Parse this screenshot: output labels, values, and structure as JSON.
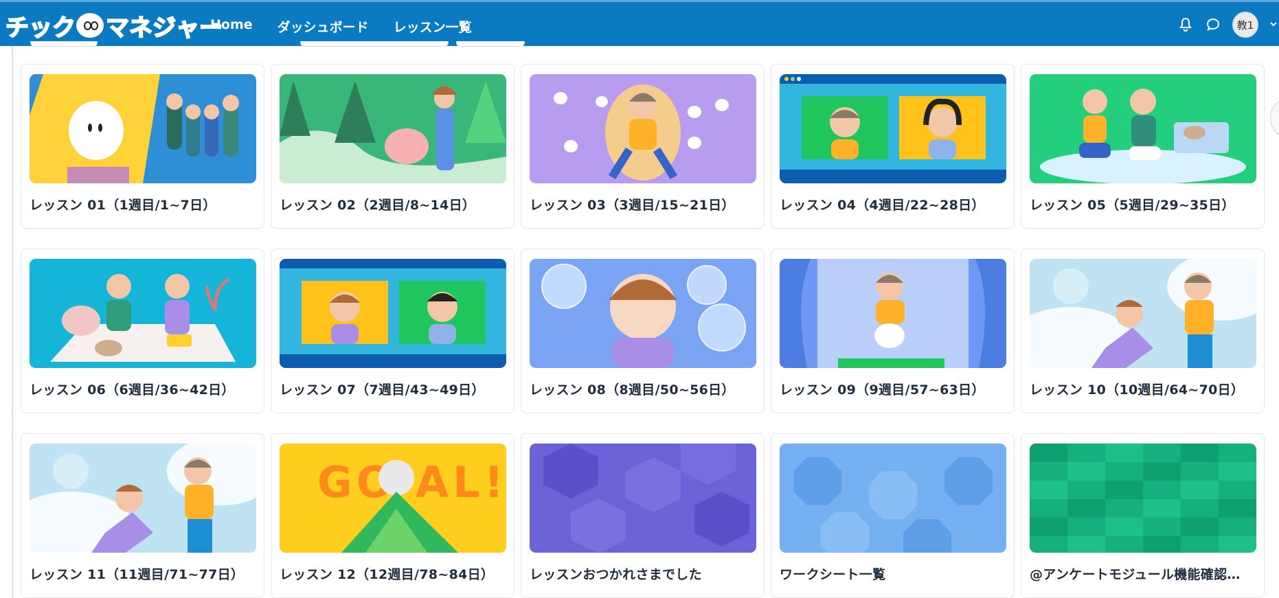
{
  "header": {
    "logo_text": "チックマネジャー",
    "nav": [
      {
        "label": "Home"
      },
      {
        "label": "ダッシュボード"
      },
      {
        "label": "レッスン一覧"
      }
    ],
    "avatar_text": "教1",
    "icons": [
      "bell-icon",
      "chat-icon",
      "chevron-down-icon"
    ],
    "colors": {
      "bar": "#0a7bc2",
      "text": "#ffffff"
    }
  },
  "lessons": [
    {
      "title": "レッスン 01（1週目/1~7日）",
      "theme": "spotlight"
    },
    {
      "title": "レッスン 02（2週目/8~14日）",
      "theme": "forest"
    },
    {
      "title": "レッスン 03（3週目/15~21日）",
      "theme": "purple-burst"
    },
    {
      "title": "レッスン 04（4週目/22~28日）",
      "theme": "video-call"
    },
    {
      "title": "レッスン 05（5週目/29~35日）",
      "theme": "green-picnic"
    },
    {
      "title": "レッスン 06（6週目/36~42日）",
      "theme": "cyan-room"
    },
    {
      "title": "レッスン 07（7週目/43~49日）",
      "theme": "video-call-2"
    },
    {
      "title": "レッスン 08（8週目/50~56日）",
      "theme": "bubbles"
    },
    {
      "title": "レッスン 09（9週目/57~63日）",
      "theme": "curtains"
    },
    {
      "title": "レッスン 10（10週目/64~70日）",
      "theme": "clouds"
    },
    {
      "title": "レッスン 11（11週目/71~77日）",
      "theme": "clouds"
    },
    {
      "title": "レッスン 12（12週目/78~84日）",
      "theme": "goal"
    },
    {
      "title": "レッスンおつかれさまでした",
      "theme": "hex-purple"
    },
    {
      "title": "ワークシート一覧",
      "theme": "octagon-blue"
    },
    {
      "title": "@アンケートモジュール機能確認…",
      "theme": "green-blocks"
    }
  ]
}
